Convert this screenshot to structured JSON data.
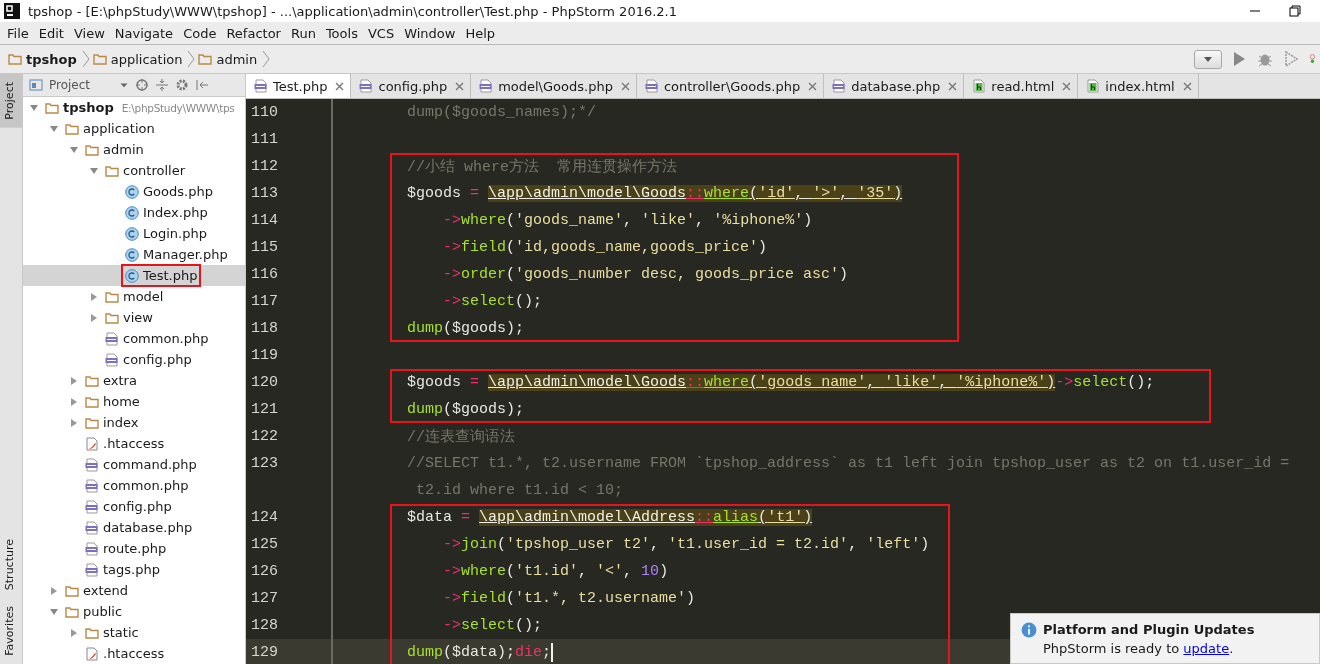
{
  "window": {
    "title": "tpshop - [E:\\phpStudy\\WWW\\tpshop] - ...\\application\\admin\\controller\\Test.php - PhpStorm 2016.2.1"
  },
  "menu": [
    "File",
    "Edit",
    "View",
    "Navigate",
    "Code",
    "Refactor",
    "Run",
    "Tools",
    "VCS",
    "Window",
    "Help"
  ],
  "breadcrumb": [
    {
      "label": "tpshop",
      "bold": true
    },
    {
      "label": "application",
      "bold": false
    },
    {
      "label": "admin",
      "bold": false
    }
  ],
  "tool_windows": {
    "top": [
      {
        "label": "Project",
        "selected": true
      }
    ],
    "bottom": [
      {
        "label": "Structure",
        "selected": false
      },
      {
        "label": "Favorites",
        "selected": false
      }
    ]
  },
  "project_panel": {
    "title": "Project",
    "tree": [
      {
        "label": "tpshop",
        "hint": "E:\\phpStudy\\WWW\\tps",
        "kind": "folder",
        "expanded": true,
        "selected": false,
        "annotated": false,
        "children": [
          {
            "label": "application",
            "kind": "folder",
            "expanded": true,
            "selected": false,
            "annotated": false,
            "children": [
              {
                "label": "admin",
                "kind": "folder",
                "expanded": true,
                "selected": false,
                "annotated": false,
                "children": [
                  {
                    "label": "controller",
                    "kind": "folder",
                    "expanded": true,
                    "selected": false,
                    "annotated": false,
                    "children": [
                      {
                        "label": "Goods.php",
                        "kind": "class",
                        "selected": false,
                        "annotated": false
                      },
                      {
                        "label": "Index.php",
                        "kind": "class",
                        "selected": false,
                        "annotated": false
                      },
                      {
                        "label": "Login.php",
                        "kind": "class",
                        "selected": false,
                        "annotated": false
                      },
                      {
                        "label": "Manager.php",
                        "kind": "class",
                        "selected": false,
                        "annotated": false
                      },
                      {
                        "label": "Test.php",
                        "kind": "class",
                        "selected": true,
                        "annotated": true
                      }
                    ]
                  },
                  {
                    "label": "model",
                    "kind": "folder",
                    "expanded": false,
                    "selected": false,
                    "annotated": false
                  },
                  {
                    "label": "view",
                    "kind": "folder",
                    "expanded": false,
                    "selected": false,
                    "annotated": false
                  },
                  {
                    "label": "common.php",
                    "kind": "php",
                    "selected": false,
                    "annotated": false
                  },
                  {
                    "label": "config.php",
                    "kind": "php",
                    "selected": false,
                    "annotated": false
                  }
                ]
              },
              {
                "label": "extra",
                "kind": "folder",
                "expanded": false,
                "selected": false,
                "annotated": false
              },
              {
                "label": "home",
                "kind": "folder",
                "expanded": false,
                "selected": false,
                "annotated": false
              },
              {
                "label": "index",
                "kind": "folder",
                "expanded": false,
                "selected": false,
                "annotated": false
              },
              {
                "label": ".htaccess",
                "kind": "htaccess",
                "selected": false,
                "annotated": false
              },
              {
                "label": "command.php",
                "kind": "php",
                "selected": false,
                "annotated": false
              },
              {
                "label": "common.php",
                "kind": "php",
                "selected": false,
                "annotated": false
              },
              {
                "label": "config.php",
                "kind": "php",
                "selected": false,
                "annotated": false
              },
              {
                "label": "database.php",
                "kind": "php",
                "selected": false,
                "annotated": false
              },
              {
                "label": "route.php",
                "kind": "php",
                "selected": false,
                "annotated": false
              },
              {
                "label": "tags.php",
                "kind": "php",
                "selected": false,
                "annotated": false
              }
            ]
          },
          {
            "label": "extend",
            "kind": "folder",
            "expanded": false,
            "selected": false,
            "annotated": false
          },
          {
            "label": "public",
            "kind": "folder",
            "expanded": true,
            "selected": false,
            "annotated": false,
            "children": [
              {
                "label": "static",
                "kind": "folder",
                "expanded": false,
                "selected": false,
                "annotated": false
              },
              {
                "label": ".htaccess",
                "kind": "htaccess",
                "selected": false,
                "annotated": false
              }
            ]
          }
        ]
      }
    ]
  },
  "tabs": [
    {
      "label": "Test.php",
      "kind": "php",
      "selected": true
    },
    {
      "label": "config.php",
      "kind": "php",
      "selected": false
    },
    {
      "label": "model\\Goods.php",
      "kind": "php",
      "selected": false
    },
    {
      "label": "controller\\Goods.php",
      "kind": "php",
      "selected": false
    },
    {
      "label": "database.php",
      "kind": "php",
      "selected": false
    },
    {
      "label": "read.html",
      "kind": "html",
      "selected": false
    },
    {
      "label": "index.html",
      "kind": "html",
      "selected": false
    }
  ],
  "editor": {
    "sections": [
      {
        "boxed": false,
        "lines": [
          {
            "number": "110",
            "current": false,
            "tokens": [
              {
                "text": "dump($goods_names);*/",
                "kind": "comment"
              }
            ]
          },
          {
            "number": "111",
            "current": false
          }
        ]
      },
      {
        "boxed": true,
        "lines": [
          {
            "number": "112",
            "current": false,
            "tokens": [
              {
                "text": "//小结 where方法  常用连贯操作方法",
                "kind": "comment"
              }
            ]
          },
          {
            "number": "113",
            "current": false,
            "tokens": [
              {
                "text": "$goods ",
                "kind": "text"
              },
              {
                "text": "= ",
                "kind": "op"
              },
              {
                "text": "\\app\\admin\\model\\Goods",
                "kind": "ref",
                "highlighted": true
              },
              {
                "text": "::",
                "kind": "op",
                "highlighted": true
              },
              {
                "text": "where",
                "kind": "fn",
                "highlighted": true
              },
              {
                "text": "(",
                "kind": "text",
                "highlighted": true
              },
              {
                "text": "'id'",
                "kind": "str",
                "highlighted": true
              },
              {
                "text": ", ",
                "kind": "text",
                "highlighted": true
              },
              {
                "text": "'>'",
                "kind": "str",
                "highlighted": true
              },
              {
                "text": ", ",
                "kind": "text",
                "highlighted": true
              },
              {
                "text": "'35'",
                "kind": "str",
                "highlighted": true
              },
              {
                "text": ")",
                "kind": "text",
                "highlighted": true
              }
            ]
          },
          {
            "number": "114",
            "current": false,
            "indented": true,
            "tokens": [
              {
                "text": "->",
                "kind": "op"
              },
              {
                "text": "where",
                "kind": "fn"
              },
              {
                "text": "(",
                "kind": "text"
              },
              {
                "text": "'goods_name'",
                "kind": "str"
              },
              {
                "text": ", ",
                "kind": "text"
              },
              {
                "text": "'like'",
                "kind": "str"
              },
              {
                "text": ", ",
                "kind": "text"
              },
              {
                "text": "'%iphone%'",
                "kind": "str"
              },
              {
                "text": ")",
                "kind": "text"
              }
            ]
          },
          {
            "number": "115",
            "current": false,
            "indented": true,
            "tokens": [
              {
                "text": "->",
                "kind": "op"
              },
              {
                "text": "field",
                "kind": "fn"
              },
              {
                "text": "(",
                "kind": "text"
              },
              {
                "text": "'id,goods_name,goods_price'",
                "kind": "str"
              },
              {
                "text": ")",
                "kind": "text"
              }
            ]
          },
          {
            "number": "116",
            "current": false,
            "indented": true,
            "tokens": [
              {
                "text": "->",
                "kind": "op"
              },
              {
                "text": "order",
                "kind": "fn"
              },
              {
                "text": "(",
                "kind": "text"
              },
              {
                "text": "'goods_number desc, goods_price asc'",
                "kind": "str"
              },
              {
                "text": ")",
                "kind": "text"
              }
            ]
          },
          {
            "number": "117",
            "current": false,
            "indented": true,
            "tokens": [
              {
                "text": "->",
                "kind": "op"
              },
              {
                "text": "select",
                "kind": "fn"
              },
              {
                "text": "();",
                "kind": "text"
              }
            ]
          },
          {
            "number": "118",
            "current": false,
            "tokens": [
              {
                "text": "dump",
                "kind": "fn"
              },
              {
                "text": "($goods);",
                "kind": "text"
              }
            ]
          }
        ]
      },
      {
        "boxed": false,
        "lines": [
          {
            "number": "119",
            "current": false
          }
        ]
      },
      {
        "boxed": true,
        "lines": [
          {
            "number": "120",
            "current": false,
            "tokens": [
              {
                "text": "$goods ",
                "kind": "text"
              },
              {
                "text": "= ",
                "kind": "op"
              },
              {
                "text": "\\app\\admin\\model\\Goods",
                "kind": "ref",
                "highlighted": true
              },
              {
                "text": "::",
                "kind": "op",
                "highlighted": true
              },
              {
                "text": "where",
                "kind": "fn",
                "highlighted": true
              },
              {
                "text": "(",
                "kind": "text",
                "highlighted": true
              },
              {
                "text": "'goods_name'",
                "kind": "str",
                "highlighted": true
              },
              {
                "text": ", ",
                "kind": "text",
                "highlighted": true
              },
              {
                "text": "'like'",
                "kind": "str",
                "highlighted": true
              },
              {
                "text": ", ",
                "kind": "text",
                "highlighted": true
              },
              {
                "text": "'%iphone%'",
                "kind": "str",
                "highlighted": true
              },
              {
                "text": ")",
                "kind": "text",
                "highlighted": true
              },
              {
                "text": "->",
                "kind": "op"
              },
              {
                "text": "select",
                "kind": "fn"
              },
              {
                "text": "();",
                "kind": "text"
              }
            ]
          },
          {
            "number": "121",
            "current": false,
            "tokens": [
              {
                "text": "dump",
                "kind": "fn"
              },
              {
                "text": "($goods);",
                "kind": "text"
              }
            ]
          }
        ]
      },
      {
        "boxed": false,
        "lines": [
          {
            "number": "122",
            "current": false,
            "tokens": [
              {
                "text": "//连表查询语法",
                "kind": "comment"
              }
            ]
          },
          {
            "number": "123",
            "current": false,
            "tokens": [
              {
                "text": "//SELECT t1.*, t2.username FROM `tpshop_address` as t1 left join tpshop_user as t2 on t1.user_id =",
                "kind": "comment"
              }
            ]
          },
          {
            "current": false,
            "tokens": [
              {
                "text": " t2.id where t1.id < 10;",
                "kind": "comment"
              }
            ]
          }
        ]
      },
      {
        "boxed": true,
        "lines": [
          {
            "number": "124",
            "current": false,
            "tokens": [
              {
                "text": "$data ",
                "kind": "text"
              },
              {
                "text": "= ",
                "kind": "op"
              },
              {
                "text": "\\app\\admin\\model\\Address",
                "kind": "ref",
                "highlighted": true
              },
              {
                "text": "::",
                "kind": "op",
                "highlighted": true
              },
              {
                "text": "alias",
                "kind": "fn",
                "highlighted": true
              },
              {
                "text": "(",
                "kind": "text",
                "highlighted": true
              },
              {
                "text": "'t1'",
                "kind": "str",
                "highlighted": true
              },
              {
                "text": ")",
                "kind": "text",
                "highlighted": true
              }
            ]
          },
          {
            "number": "125",
            "current": false,
            "indented": true,
            "tokens": [
              {
                "text": "->",
                "kind": "op"
              },
              {
                "text": "join",
                "kind": "fn"
              },
              {
                "text": "(",
                "kind": "text"
              },
              {
                "text": "'tpshop_user t2'",
                "kind": "str"
              },
              {
                "text": ", ",
                "kind": "text"
              },
              {
                "text": "'t1.user_id = t2.id'",
                "kind": "str"
              },
              {
                "text": ", ",
                "kind": "text"
              },
              {
                "text": "'left'",
                "kind": "str"
              },
              {
                "text": ")",
                "kind": "text"
              }
            ]
          },
          {
            "number": "126",
            "current": false,
            "indented": true,
            "tokens": [
              {
                "text": "->",
                "kind": "op"
              },
              {
                "text": "where",
                "kind": "fn"
              },
              {
                "text": "(",
                "kind": "text"
              },
              {
                "text": "'t1.id'",
                "kind": "str"
              },
              {
                "text": ", ",
                "kind": "text"
              },
              {
                "text": "'<'",
                "kind": "str"
              },
              {
                "text": ", ",
                "kind": "text"
              },
              {
                "text": "10",
                "kind": "num"
              },
              {
                "text": ")",
                "kind": "text"
              }
            ]
          },
          {
            "number": "127",
            "current": false,
            "indented": true,
            "tokens": [
              {
                "text": "->",
                "kind": "op"
              },
              {
                "text": "field",
                "kind": "fn"
              },
              {
                "text": "(",
                "kind": "text"
              },
              {
                "text": "'t1.*, t2.username'",
                "kind": "str"
              },
              {
                "text": ")",
                "kind": "text"
              }
            ]
          },
          {
            "number": "128",
            "current": false,
            "indented": true,
            "tokens": [
              {
                "text": "->",
                "kind": "op"
              },
              {
                "text": "select",
                "kind": "fn"
              },
              {
                "text": "();",
                "kind": "text"
              }
            ]
          },
          {
            "number": "129",
            "current": true,
            "tokens": [
              {
                "text": "dump",
                "kind": "fn"
              },
              {
                "text": "($data);",
                "kind": "text"
              },
              {
                "text": "die",
                "kind": "op"
              },
              {
                "text": ";",
                "kind": "text"
              }
            ]
          }
        ]
      }
    ]
  },
  "notification": {
    "title": "Platform and Plugin Updates",
    "text": "PhpStorm is ready to ",
    "link": "update",
    "after": "."
  }
}
